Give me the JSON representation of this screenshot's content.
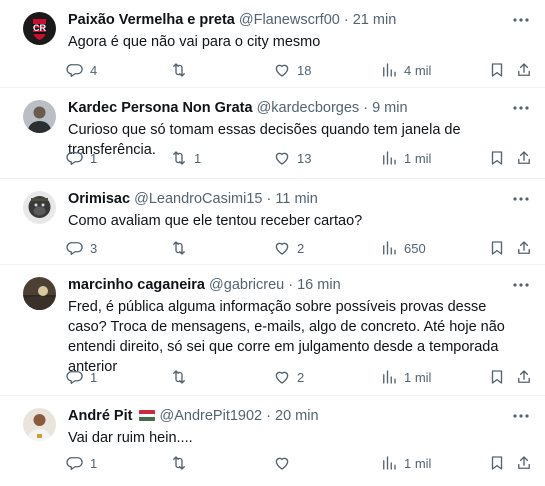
{
  "tweets": [
    {
      "name": "Paixão Vermelha e preta",
      "handle": "@Flanewscrf00",
      "dot": "·",
      "time": "21 min",
      "text": "Agora é que não vai para o city mesmo",
      "replies": "4",
      "retweets": "",
      "likes": "18",
      "views": "4 mil",
      "avatar_icon": "flamengo-crest-avatar"
    },
    {
      "name": "Kardec Persona Non Grata",
      "handle": "@kardecborges",
      "dot": "·",
      "time": "9 min",
      "text": "Curioso que só tomam essas decisões quando tem janela de transferência.",
      "replies": "1",
      "retweets": "1",
      "likes": "13",
      "views": "1 mil",
      "avatar_icon": "person-avatar"
    },
    {
      "name": "Orimisac",
      "handle": "@LeandroCasimi15",
      "dot": "·",
      "time": "11 min",
      "text": "Como avaliam que ele tentou receber cartao?",
      "replies": "3",
      "retweets": "",
      "likes": "2",
      "views": "650",
      "avatar_icon": "gorilla-avatar"
    },
    {
      "name": "marcinho caganeira",
      "handle": "@gabricreu",
      "dot": "·",
      "time": "16 min",
      "text": "Fred, é pública alguma informação sobre possíveis provas desse caso? Troca de mensagens, e-mails, algo de concreto. Até hoje não entendi direito, só sei que corre em julgamento desde a temporada anterior",
      "replies": "1",
      "retweets": "",
      "likes": "2",
      "views": "1 mil",
      "avatar_icon": "sunset-avatar"
    },
    {
      "name": "André Pit",
      "handle": "@AndrePit1902",
      "dot": "·",
      "time": "20 min",
      "text": "Vai dar ruim hein....",
      "replies": "1",
      "retweets": "",
      "likes": "",
      "views": "1 mil",
      "avatar_icon": "person-avatar"
    }
  ],
  "colors": {
    "text": "#0f1419",
    "secondary": "#536471",
    "divider": "#eff3f4",
    "flag_red": "#cd2a3e",
    "flag_white": "#ffffff",
    "flag_green": "#436f4d"
  }
}
